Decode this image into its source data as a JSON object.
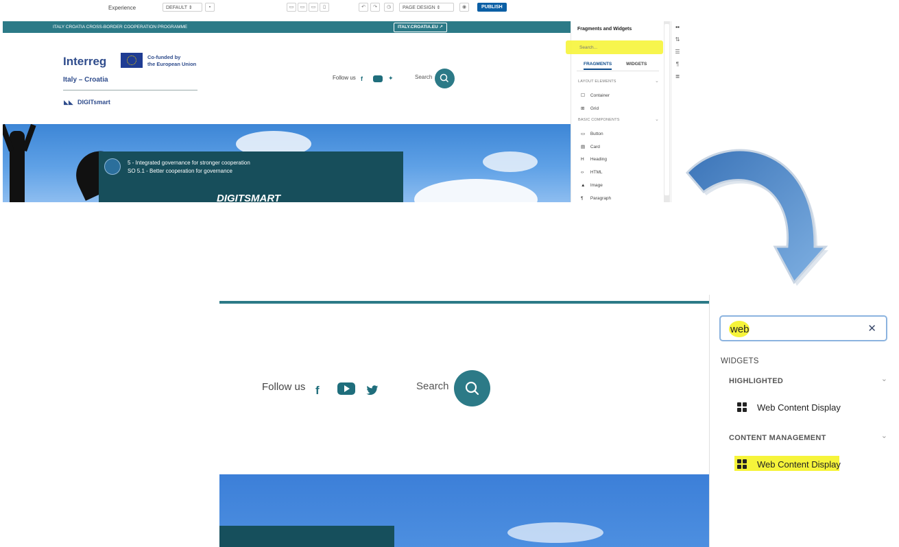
{
  "editor": {
    "toolbar": {
      "experience_label": "Experience",
      "experience_value": "DEFAULT",
      "mode_value": "PAGE DESIGN",
      "publish_label": "PUBLISH"
    },
    "site": {
      "banner_text": "ITALY CROATIA CROSS-BORDER COOPERATION PROGRAMME",
      "banner_link": "ITALY.CROATIA.EU",
      "logo_word": "Interreg",
      "cofunded": "Co-funded by",
      "cofunded_line2": "the European Union",
      "region": "Italy – Croatia",
      "project": "DIGITsmart",
      "follow_us": "Follow us",
      "search_label": "Search",
      "hero_line1": "5 - Integrated governance for stronger cooperation",
      "hero_line2": "SO 5.1 - Better cooperation for governance",
      "hero_title": "DIGITSMART"
    },
    "sidebar": {
      "title": "Fragments and Widgets",
      "search_placeholder": "Search...",
      "tabs": [
        "FRAGMENTS",
        "WIDGETS"
      ],
      "sections": [
        {
          "label": "LAYOUT ELEMENTS",
          "items": [
            "Container",
            "Grid"
          ]
        },
        {
          "label": "BASIC COMPONENTS",
          "items": [
            "Button",
            "Card",
            "Heading",
            "HTML",
            "Image",
            "Paragraph"
          ]
        }
      ]
    }
  },
  "zoomed": {
    "follow_us": "Follow us",
    "search_label": "Search",
    "search_value": "web",
    "widgets_heading": "WIDGETS",
    "sections": [
      {
        "label": "HIGHLIGHTED",
        "item": "Web Content Display"
      },
      {
        "label": "CONTENT MANAGEMENT",
        "item": "Web Content Display"
      }
    ]
  },
  "colors": {
    "teal": "#2c7a87",
    "highlight": "#f6f43a",
    "publish_blue": "#0b5fa5",
    "arrow_blue": "#4a84c6"
  },
  "icons": {
    "search": "search-icon",
    "facebook": "facebook-icon",
    "youtube": "youtube-icon",
    "twitter": "twitter-icon",
    "clear": "clear-icon",
    "widget": "grid-icon"
  }
}
